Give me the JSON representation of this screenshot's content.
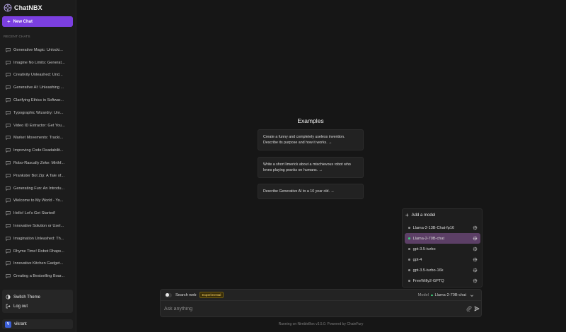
{
  "app": {
    "brand": "ChatNBX"
  },
  "sidebar": {
    "new_chat_label": "New Chat",
    "recent_label": "RECENT CHATS",
    "chats": [
      "Generative Magic: Unlocki...",
      "Imagine No Limits: Generat...",
      "Creativity Unleashed: Und...",
      "Generative AI: Unleashing ...",
      "Clarifying Ethics in Softwar...",
      "Typographic Wizardry: Unr...",
      "Video ID Extractor: Get You...",
      "Market Movements: Tracki...",
      "Improving Code Readabilit...",
      "Robo-Rascally Zeke: Mirthf...",
      "Prankster Bot Zip: A Tale of...",
      "Generating Fun: An Introdu...",
      "Welcome to My World - Yo...",
      "Hello! Let's Get Started!",
      "Innovative Solution or Usel...",
      "Imagination Unleashed: Th...",
      "Rhyme Time! Robot Rhaps...",
      "Innovative Kitchen Gadget...",
      "Creating a Bestselling Boar..."
    ],
    "switch_theme_label": "Switch Theme",
    "logout_label": "Log out",
    "user": {
      "initial": "V",
      "name": "vikrant"
    }
  },
  "examples": {
    "title": "Examples",
    "items": [
      "Create a funny and completely useless invention. Describe its purpose and how it works. →",
      "Write a short limerick about a mischievous robot who loves playing pranks on humans. →",
      "Describe Generative AI to a 10 year old. →"
    ]
  },
  "model_popup": {
    "add_label": "Add a model",
    "models": [
      {
        "name": "Llama-2-13B-Chat-fp16",
        "selected": false
      },
      {
        "name": "Llama-2-70B-chat",
        "selected": true
      },
      {
        "name": "gpt-3.5-turbo",
        "selected": false
      },
      {
        "name": "gpt-4",
        "selected": false
      },
      {
        "name": "gpt-3.5-turbo-16k",
        "selected": false
      },
      {
        "name": "FreeWilly2-GPTQ",
        "selected": false
      }
    ]
  },
  "input": {
    "search_web_label": "Search web",
    "badge": "Experimental",
    "model_label": "Model",
    "model_value": "Llama-2-70B-chat",
    "placeholder": "Ask anything"
  },
  "footer": {
    "text": "Running on NimbleBox v3.5.0. Powered by ChainFury"
  },
  "colors": {
    "accent": "#7b3fe0",
    "selected_model_bg": "#5c3f66",
    "status_green": "#3ad07a",
    "badge_text": "#ffd76b"
  }
}
